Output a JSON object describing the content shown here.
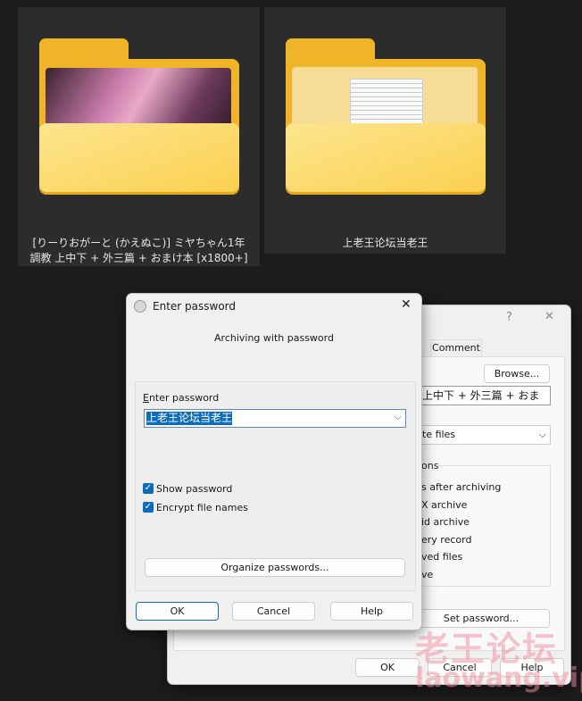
{
  "folders": [
    {
      "name": "[りーりおがーと (かえぬこ)] ミヤちゃん1年 調教 上中下 + 外三篇 + おまけ本 [x1800+]",
      "line1": "[りーりおがーと (かえぬこ)] ミヤちゃん1年",
      "line2": "調教 上中下 + 外三篇 + おまけ本 [x1800+]"
    },
    {
      "name": "上老王论坛当老王"
    }
  ],
  "back_dialog": {
    "help_glyph": "?",
    "close_glyph": "✕",
    "tab_comment": "Comment",
    "browse_label": "Browse...",
    "archive_name_partial": "上中下 + 外三篇 + おま",
    "update_mode_partial": "te files",
    "options_group_partial": "ons",
    "options_partial": [
      "s after archiving",
      "X archive",
      "id archive",
      "ery record",
      "ved files",
      "ve"
    ],
    "set_password_partial": "Set password...",
    "ok_label": "OK",
    "cancel_label": "Cancel",
    "help_label": "Help"
  },
  "password_dialog": {
    "title": "Enter password",
    "close_glyph": "✕",
    "subtitle": "Archiving with password",
    "field_label": "Enter password",
    "password_value": "上老王论坛当老王",
    "show_password": {
      "label": "Show password",
      "checked": true
    },
    "encrypt_names": {
      "label": "Encrypt file names",
      "checked": true
    },
    "organize_label": "Organize passwords...",
    "ok_label": "OK",
    "cancel_label": "Cancel",
    "help_label": "Help"
  },
  "watermark": {
    "line1": "老王论坛",
    "line2": "laowang.vip"
  },
  "colors": {
    "accent": "#0f6cbd",
    "folder": "#f0b429"
  }
}
